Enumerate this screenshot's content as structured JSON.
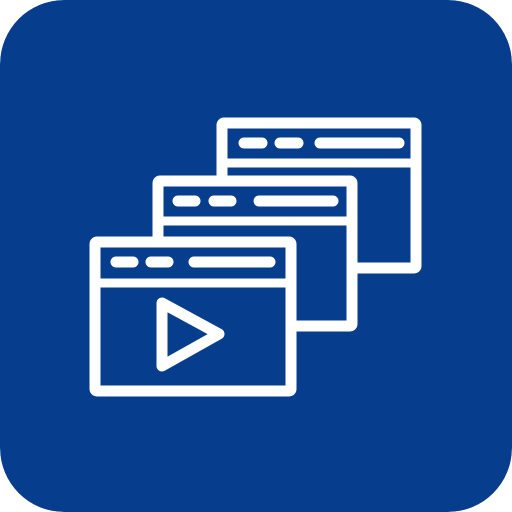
{
  "app_icon": {
    "icon_name": "stacked-video-windows-icon",
    "background_color": "#063e8d",
    "stroke_color": "#ffffff"
  }
}
